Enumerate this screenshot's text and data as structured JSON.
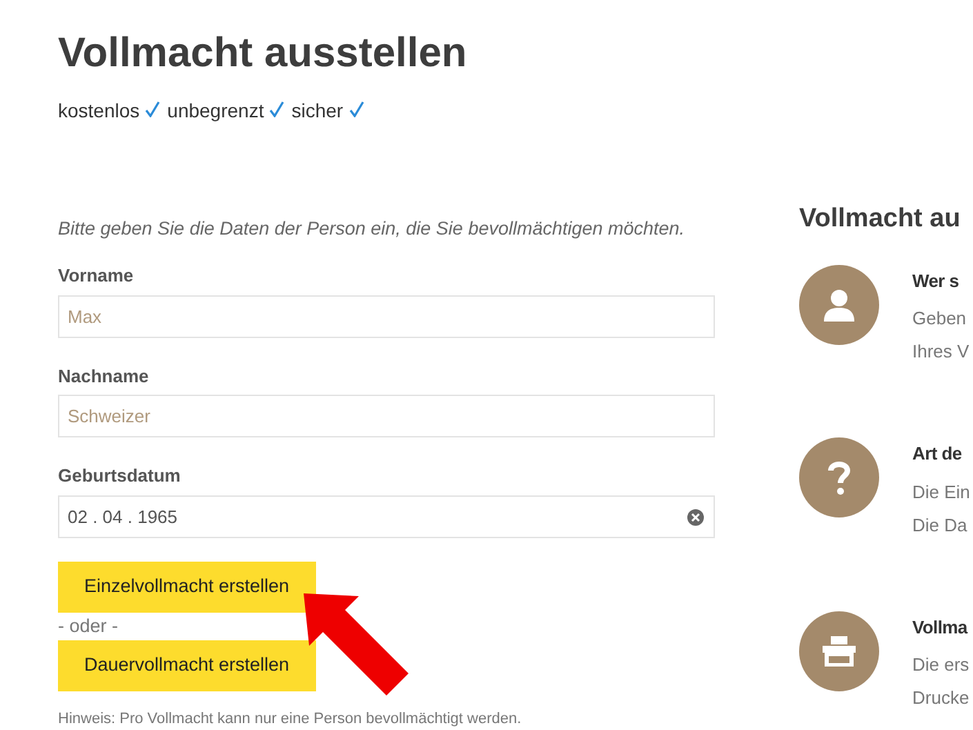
{
  "title": "Vollmacht ausstellen",
  "features": [
    {
      "label": "kostenlos",
      "checked": true
    },
    {
      "label": "unbegrenzt",
      "checked": true
    },
    {
      "label": "sicher",
      "checked": true
    }
  ],
  "form": {
    "intro": "Bitte geben Sie die Daten der Person ein, die Sie bevollmächtigen möchten.",
    "fields": [
      {
        "label": "Vorname",
        "placeholder": "Max",
        "kind": "text"
      },
      {
        "label": "Nachname",
        "placeholder": "Schweizer",
        "kind": "text"
      },
      {
        "label": "Geburtsdatum",
        "value": "02 . 04 . 1965",
        "kind": "date"
      }
    ],
    "buttons": [
      "Einzelvollmacht erstellen",
      "Dauervollmacht erstellen"
    ],
    "separator": "- oder -",
    "note": "Hinweis: Pro Vollmacht kann nur eine Person bevollmächtigt werden."
  },
  "steps_panel": {
    "title": "Vollmacht au",
    "steps": [
      {
        "kind": "person",
        "title": "Wer s",
        "lines": [
          "Geben",
          "Ihres V"
        ]
      },
      {
        "kind": "question",
        "title": "Art de",
        "lines": [
          "Die Ein",
          "Die Da"
        ]
      },
      {
        "kind": "printer",
        "title": "Vollma",
        "lines": [
          "Die ers",
          "Drucke"
        ]
      }
    ]
  }
}
